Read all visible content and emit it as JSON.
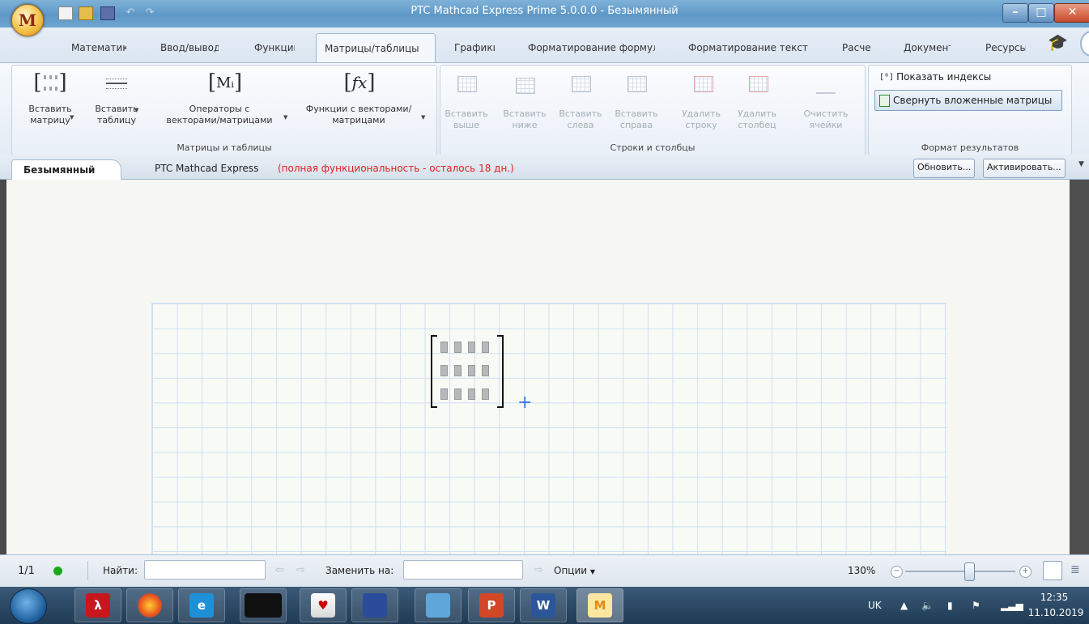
{
  "window": {
    "title": "PTC Mathcad Express Prime 5.0.0.0 - Безымянный",
    "app_letter": "M"
  },
  "ribbon_tabs": [
    {
      "label": "Математика"
    },
    {
      "label": "Ввод/вывод"
    },
    {
      "label": "Функции"
    },
    {
      "label": "Матрицы/таблицы"
    },
    {
      "label": "Графики"
    },
    {
      "label": "Форматирование формул"
    },
    {
      "label": "Форматирование текста"
    },
    {
      "label": "Расчет"
    },
    {
      "label": "Документ"
    },
    {
      "label": "Ресурсы"
    }
  ],
  "groups": {
    "matrices": {
      "label": "Матрицы и таблицы",
      "insert_matrix": [
        "Вставить",
        "матрицу"
      ],
      "insert_table": [
        "Вставить",
        "таблицу"
      ],
      "operators": [
        "Операторы с",
        "векторами/матрицами"
      ],
      "operators_icon": "Mᵢ",
      "functions": [
        "Функции с векторами/",
        "матрицами"
      ],
      "functions_icon": "fx"
    },
    "rows_cols": {
      "label": "Строки и столбцы",
      "insert_above": [
        "Вставить",
        "выше"
      ],
      "insert_below": [
        "Вставить",
        "ниже"
      ],
      "insert_left": [
        "Вставить",
        "слева"
      ],
      "insert_right": [
        "Вставить",
        "справа"
      ],
      "delete_row": [
        "Удалить",
        "строку"
      ],
      "delete_col": [
        "Удалить",
        "столбец"
      ],
      "clear_cells": [
        "Очистить",
        "ячейки"
      ]
    },
    "result_format": {
      "label": "Формат результатов",
      "show_indices": "Показать индексы",
      "collapse_nested": "Свернуть вложенные матрицы"
    }
  },
  "docbar": {
    "tab": "Безымянный",
    "product": "PTC Mathcad Express",
    "notice": "(полная функциональность - осталось 18 дн.)",
    "update_btn": "Обновить...",
    "activate_btn": "Активировать..."
  },
  "statusbar": {
    "page": "1/1",
    "find_label": "Найти:",
    "find_value": "",
    "replace_label": "Заменить на:",
    "replace_value": "",
    "options": "Опции",
    "zoom": "130%",
    "zoom_level_percent": 130
  },
  "taskbar": {
    "lang": "UK",
    "time": "12:35",
    "date": "11.10.2019"
  },
  "colors": {
    "trial_notice": "#e02020",
    "status_ok": "#19a81c",
    "cursor": "#3e7fd6"
  }
}
